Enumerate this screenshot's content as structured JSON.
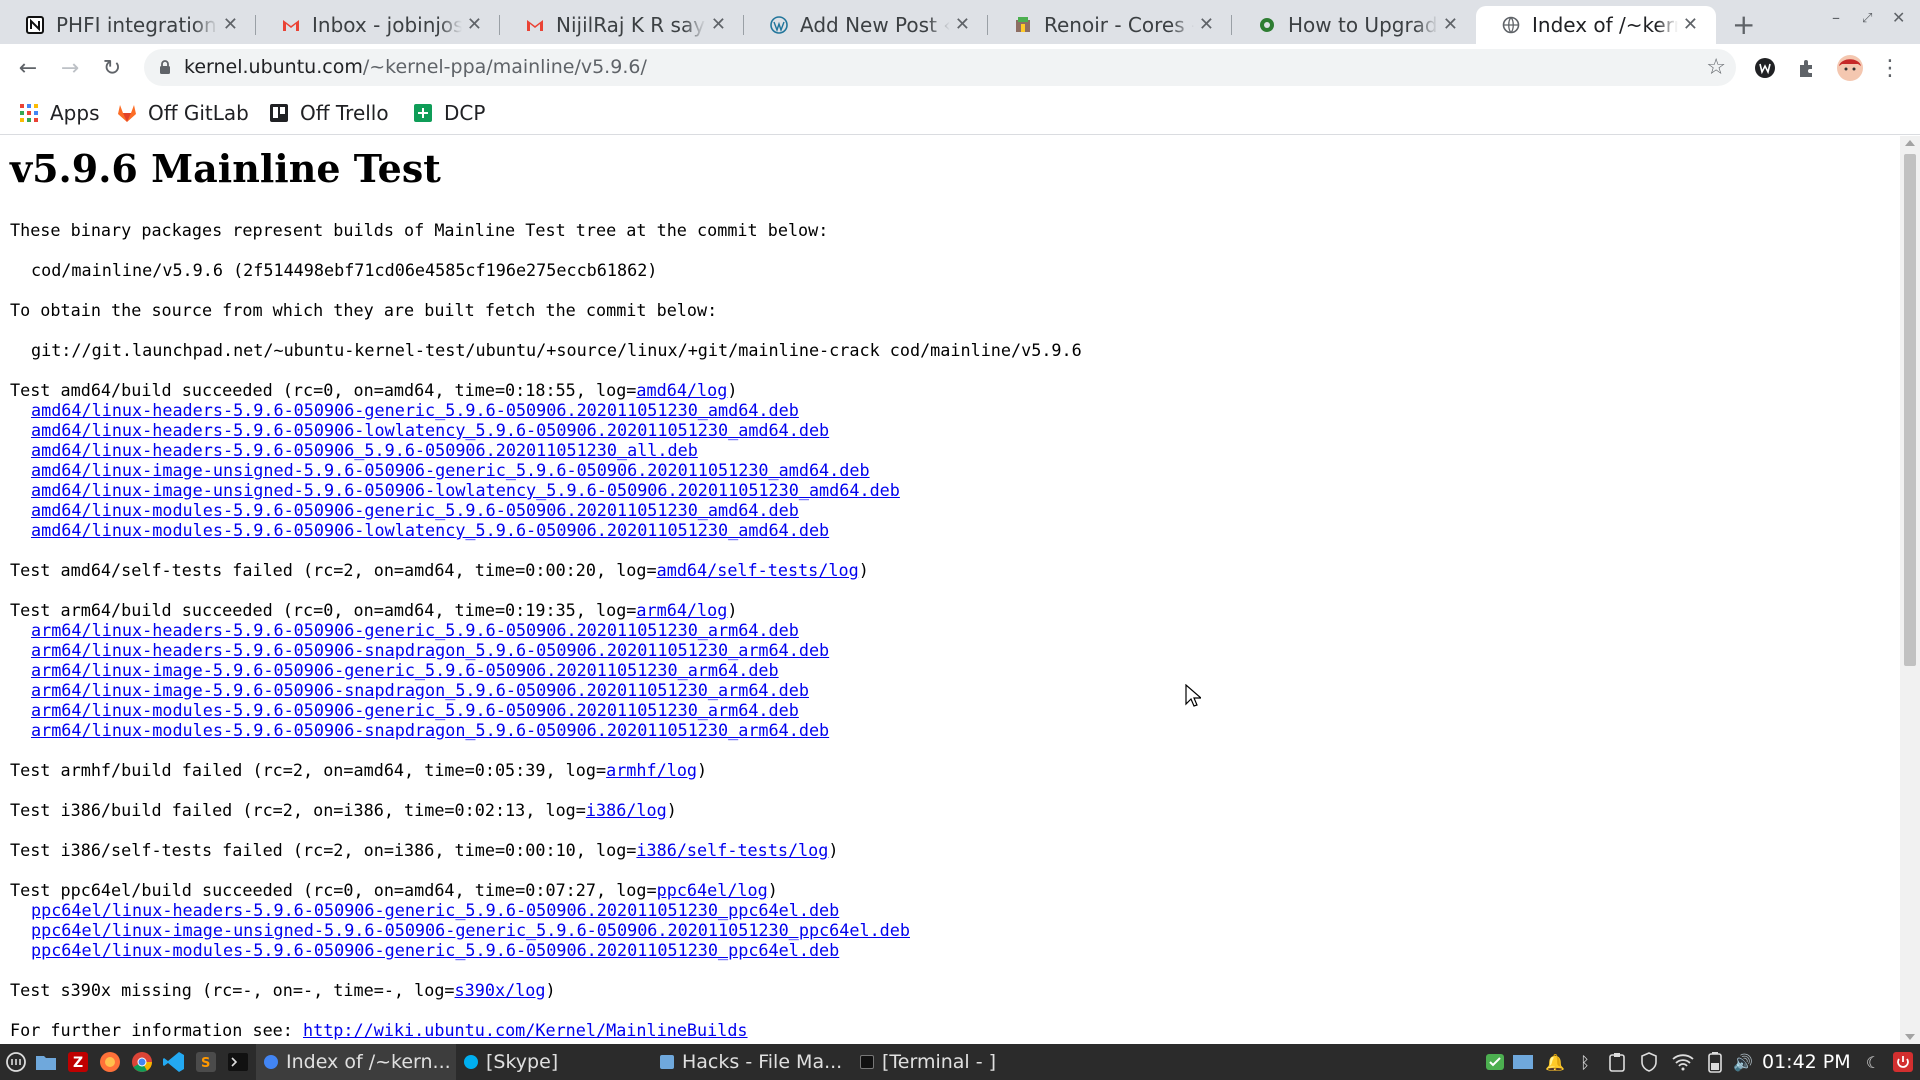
{
  "browser": {
    "tabs": [
      {
        "title": "PHFI integrations",
        "icon": "notion-icon"
      },
      {
        "title": "Inbox - jobinjose@",
        "icon": "gmail-icon"
      },
      {
        "title": "NijilRaj K R says…",
        "icon": "gmail-icon"
      },
      {
        "title": "Add New Post ‹ W",
        "icon": "wordpress-icon"
      },
      {
        "title": "Renoir - Cores - A",
        "icon": "renoir-icon"
      },
      {
        "title": "How to Upgrade",
        "icon": "gear-site-icon"
      },
      {
        "title": "Index of /~kernel",
        "icon": "globe-icon",
        "active": true
      }
    ],
    "close_glyph": "✕",
    "new_tab_glyph": "+",
    "url_host": "kernel.ubuntu.com",
    "url_path": "/~kernel-ppa/mainline/v5.9.6/",
    "bookmarks": [
      {
        "label": "Apps",
        "icon": "apps-grid-icon"
      },
      {
        "label": "Off GitLab",
        "icon": "gitlab-icon"
      },
      {
        "label": "Off Trello",
        "icon": "trello-icon"
      },
      {
        "label": "DCP",
        "icon": "sheets-icon"
      }
    ]
  },
  "page": {
    "heading": "v5.9.6 Mainline Test",
    "intro": "These binary packages represent builds of Mainline Test tree at the commit below:",
    "commit": "cod/mainline/v5.9.6 (2f514498ebf71cd06e4585cf196e275eccb61862)",
    "source_intro": "To obtain the source from which they are built fetch the commit below:",
    "git_url": "git://git.launchpad.net/~ubuntu-kernel-test/ubuntu/+source/linux/+git/mainline-crack cod/mainline/v5.9.6",
    "tests": [
      {
        "prefix": "Test amd64/build succeeded (rc=0, on=amd64, time=0:18:55, log=",
        "log": "amd64/log",
        "suffix": ")",
        "files": [
          "amd64/linux-headers-5.9.6-050906-generic_5.9.6-050906.202011051230_amd64.deb",
          "amd64/linux-headers-5.9.6-050906-lowlatency_5.9.6-050906.202011051230_amd64.deb",
          "amd64/linux-headers-5.9.6-050906_5.9.6-050906.202011051230_all.deb",
          "amd64/linux-image-unsigned-5.9.6-050906-generic_5.9.6-050906.202011051230_amd64.deb",
          "amd64/linux-image-unsigned-5.9.6-050906-lowlatency_5.9.6-050906.202011051230_amd64.deb",
          "amd64/linux-modules-5.9.6-050906-generic_5.9.6-050906.202011051230_amd64.deb",
          "amd64/linux-modules-5.9.6-050906-lowlatency_5.9.6-050906.202011051230_amd64.deb"
        ]
      },
      {
        "prefix": "Test amd64/self-tests failed (rc=2, on=amd64, time=0:00:20, log=",
        "log": "amd64/self-tests/log",
        "suffix": ")",
        "files": []
      },
      {
        "prefix": "Test arm64/build succeeded (rc=0, on=amd64, time=0:19:35, log=",
        "log": "arm64/log",
        "suffix": ")",
        "files": [
          "arm64/linux-headers-5.9.6-050906-generic_5.9.6-050906.202011051230_arm64.deb",
          "arm64/linux-headers-5.9.6-050906-snapdragon_5.9.6-050906.202011051230_arm64.deb",
          "arm64/linux-image-5.9.6-050906-generic_5.9.6-050906.202011051230_arm64.deb",
          "arm64/linux-image-5.9.6-050906-snapdragon_5.9.6-050906.202011051230_arm64.deb",
          "arm64/linux-modules-5.9.6-050906-generic_5.9.6-050906.202011051230_arm64.deb",
          "arm64/linux-modules-5.9.6-050906-snapdragon_5.9.6-050906.202011051230_arm64.deb"
        ]
      },
      {
        "prefix": "Test armhf/build failed (rc=2, on=amd64, time=0:05:39, log=",
        "log": "armhf/log",
        "suffix": ")",
        "files": []
      },
      {
        "prefix": "Test i386/build failed (rc=2, on=i386, time=0:02:13, log=",
        "log": "i386/log",
        "suffix": ")",
        "files": []
      },
      {
        "prefix": "Test i386/self-tests failed (rc=2, on=i386, time=0:00:10, log=",
        "log": "i386/self-tests/log",
        "suffix": ")",
        "files": []
      },
      {
        "prefix": "Test ppc64el/build succeeded (rc=0, on=amd64, time=0:07:27, log=",
        "log": "ppc64el/log",
        "suffix": ")",
        "files": [
          "ppc64el/linux-headers-5.9.6-050906-generic_5.9.6-050906.202011051230_ppc64el.deb",
          "ppc64el/linux-image-unsigned-5.9.6-050906-generic_5.9.6-050906.202011051230_ppc64el.deb",
          "ppc64el/linux-modules-5.9.6-050906-generic_5.9.6-050906.202011051230_ppc64el.deb"
        ]
      },
      {
        "prefix": "Test s390x missing (rc=-, on=-, time=-, log=",
        "log": "s390x/log",
        "suffix": ")",
        "files": []
      }
    ],
    "further_prefix": "For further information see: ",
    "further_link": "http://wiki.ubuntu.com/Kernel/MainlineBuilds"
  },
  "taskbar": {
    "launchers": [
      "menu-icon",
      "files-icon",
      "filezilla-icon",
      "firefox-icon",
      "chrome-icon",
      "vscode-icon",
      "sublime-icon",
      "terminal-icon"
    ],
    "windows": [
      {
        "label": "Index of /~kern...",
        "icon": "chrome-icon",
        "active": true
      },
      {
        "label": "[Skype]",
        "icon": "skype-icon"
      },
      {
        "label": "Hacks - File Ma...",
        "icon": "folder-icon"
      },
      {
        "label": "[Terminal - ]",
        "icon": "terminal-icon"
      }
    ],
    "clock": "01:42 PM"
  },
  "colors": {
    "link": "#0000ee",
    "tabstrip": "#dee1e6",
    "taskbar": "#2b2b2b"
  }
}
